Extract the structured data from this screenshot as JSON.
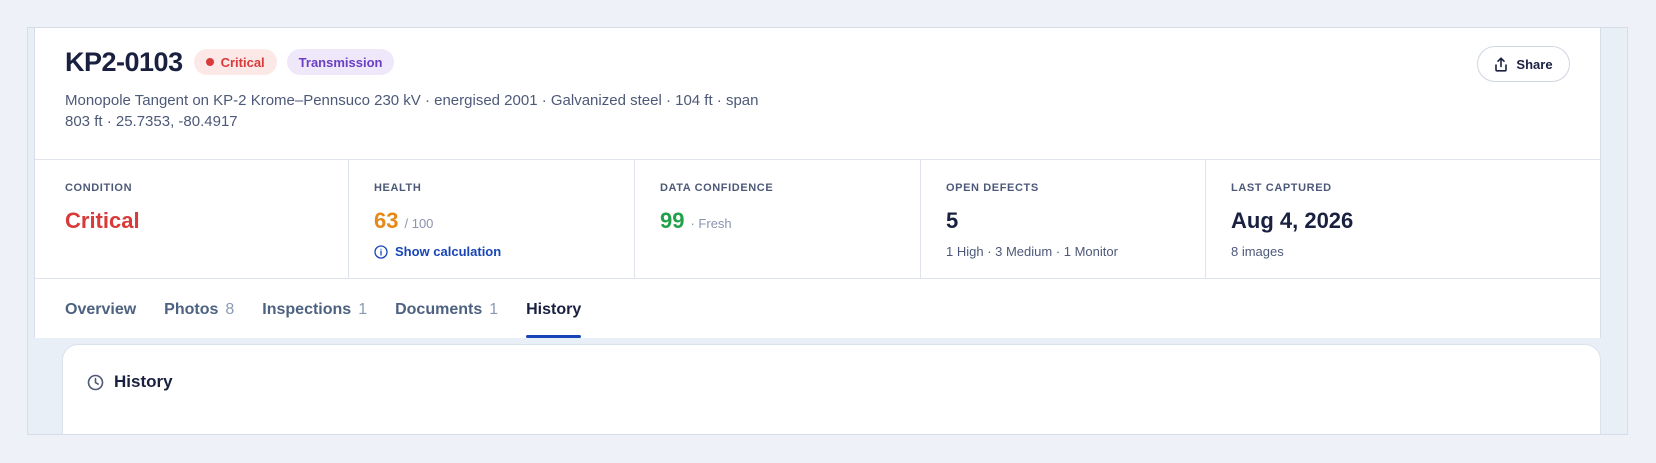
{
  "asset": {
    "id": "KP2-0103",
    "status_badge": "Critical",
    "type_badge": "Transmission",
    "description": "Monopole Tangent on KP-2 Krome–Pennsuco 230 kV · energised 2001 · Galvanized steel · 104 ft · span 803 ft · 25.7353, -80.4917"
  },
  "actions": {
    "share_label": "Share"
  },
  "stats": {
    "condition": {
      "label": "CONDITION",
      "value": "Critical"
    },
    "health": {
      "label": "HEALTH",
      "value": "63",
      "suffix": "/ 100",
      "link": "Show calculation"
    },
    "confidence": {
      "label": "DATA CONFIDENCE",
      "value": "99",
      "suffix": "· Fresh"
    },
    "defects": {
      "label": "OPEN DEFECTS",
      "value": "5",
      "sub": "1 High · 3 Medium · 1 Monitor"
    },
    "captured": {
      "label": "LAST CAPTURED",
      "value": "Aug 4, 2026",
      "sub": "8 images"
    }
  },
  "tabs": [
    {
      "label": "Overview",
      "count": ""
    },
    {
      "label": "Photos",
      "count": "8"
    },
    {
      "label": "Inspections",
      "count": "1"
    },
    {
      "label": "Documents",
      "count": "1"
    },
    {
      "label": "History",
      "count": ""
    }
  ],
  "history": {
    "title": "History"
  },
  "colors": {
    "critical": "#d93a3a",
    "health": "#e58a18",
    "confidence": "#22a04a",
    "accent": "#1846b8",
    "transmission": "#6a3fc4"
  },
  "icons": {
    "share": "share-icon",
    "info": "info-icon",
    "clock": "clock-icon"
  }
}
